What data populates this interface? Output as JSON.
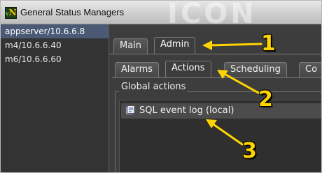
{
  "window": {
    "title": "General Status Managers",
    "logo_text": "N",
    "logo_small": "v",
    "watermark": "ICON"
  },
  "sidebar": {
    "servers": [
      {
        "label": "appserver/10.6.6.8",
        "selected": true
      },
      {
        "label": "m4/10.6.6.40",
        "selected": false
      },
      {
        "label": "m6/10.6.6.60",
        "selected": false
      }
    ]
  },
  "main": {
    "top_tabs": [
      {
        "label": "Main",
        "active": false
      },
      {
        "label": "Admin",
        "active": true
      }
    ],
    "sub_tabs": [
      {
        "label": "Alarms",
        "active": false
      },
      {
        "label": "Actions",
        "active": true
      },
      {
        "label": "Scheduling",
        "active": false
      },
      {
        "label": "Co",
        "active": false
      }
    ],
    "group_title": "Global actions",
    "actions": [
      {
        "label": "SQL event log (local)",
        "icon": "database-icon"
      }
    ]
  },
  "annotations": {
    "num_1": "1",
    "num_2": "2",
    "num_3": "3",
    "color": "#ffd400"
  }
}
